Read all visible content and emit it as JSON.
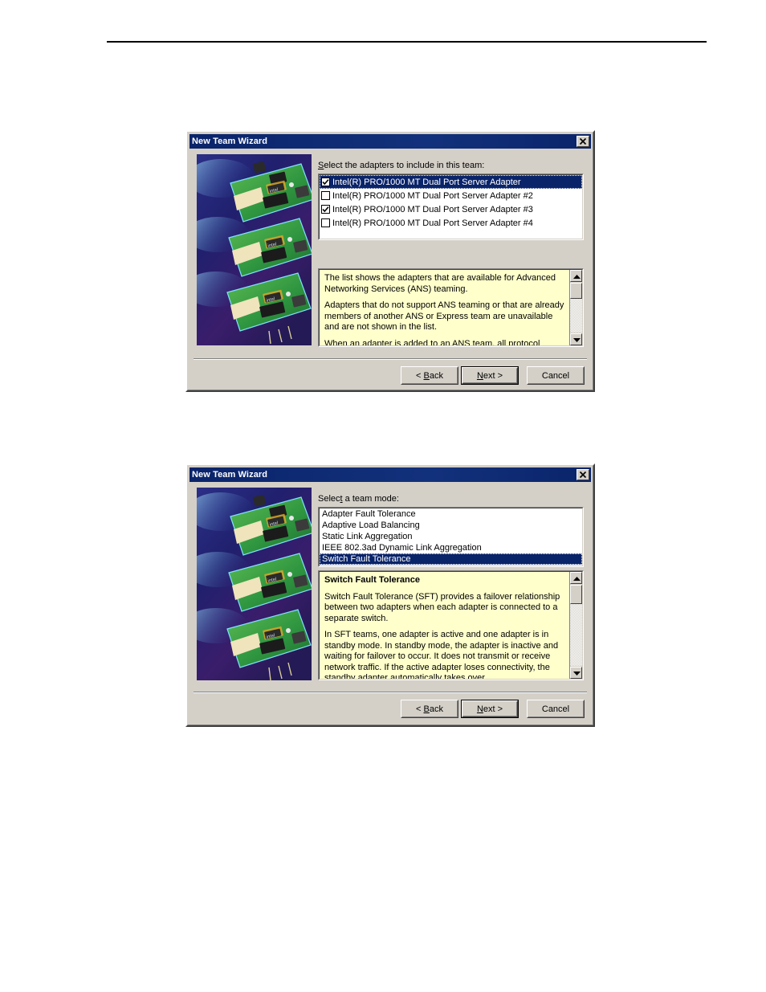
{
  "page": {
    "rule_visible": true
  },
  "dialog1": {
    "title": "New Team Wizard",
    "close_icon": "close-icon",
    "sidebar_image_alt": "intel-network-adapter-cards-artwork",
    "label": "Select the adapters to include in this team:",
    "label_accesskey": "S",
    "adapters": [
      {
        "name": "Intel(R) PRO/1000 MT Dual Port Server Adapter",
        "checked": true,
        "selected": true
      },
      {
        "name": "Intel(R) PRO/1000 MT Dual Port Server Adapter #2",
        "checked": false,
        "selected": false
      },
      {
        "name": "Intel(R) PRO/1000 MT Dual Port Server Adapter #3",
        "checked": true,
        "selected": false
      },
      {
        "name": "Intel(R) PRO/1000 MT Dual Port Server Adapter #4",
        "checked": false,
        "selected": false
      }
    ],
    "help": {
      "paragraphs": [
        "The list shows the adapters that are available for Advanced Networking Services (ANS) teaming.",
        "Adapters that do not support ANS teaming or that are already members of another ANS or Express team are unavailable and are not shown in the list.",
        "When an adapter is added to an ANS team, all protocol"
      ]
    },
    "buttons": {
      "back": "< Back",
      "back_accesskey": "B",
      "next": "Next >",
      "next_accesskey": "N",
      "cancel": "Cancel"
    }
  },
  "dialog2": {
    "title": "New Team Wizard",
    "close_icon": "close-icon",
    "sidebar_image_alt": "intel-network-adapter-cards-artwork",
    "label": "Select a team mode:",
    "label_accesskey": "t",
    "modes": [
      {
        "name": "Adapter Fault Tolerance",
        "selected": false
      },
      {
        "name": "Adaptive Load Balancing",
        "selected": false
      },
      {
        "name": "Static Link Aggregation",
        "selected": false
      },
      {
        "name": "IEEE 802.3ad Dynamic Link Aggregation",
        "selected": false
      },
      {
        "name": "Switch Fault Tolerance",
        "selected": true
      }
    ],
    "help": {
      "title": "Switch Fault Tolerance",
      "paragraphs": [
        "Switch Fault Tolerance (SFT) provides a failover relationship between two adapters when each adapter is connected to a separate switch.",
        "In SFT teams, one adapter is active and one adapter is in standby mode. In standby mode, the adapter is inactive and waiting for failover to occur. It does not transmit or receive network traffic. If the active adapter loses connectivity, the standby adapter automatically takes over."
      ]
    },
    "buttons": {
      "back": "< Back",
      "back_accesskey": "B",
      "next": "Next >",
      "next_accesskey": "N",
      "cancel": "Cancel"
    }
  },
  "colors": {
    "titlebar": "#0a246a",
    "dialog_face": "#d4d0c8",
    "help_background": "#ffffcc",
    "selection": "#0a246a"
  }
}
